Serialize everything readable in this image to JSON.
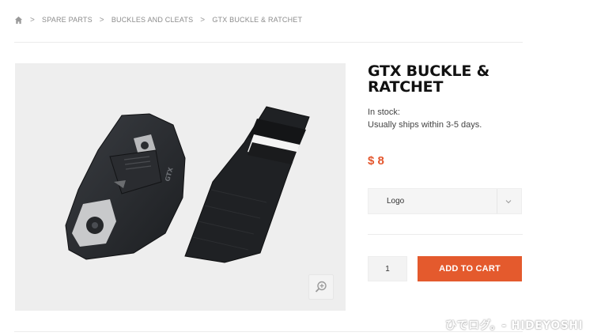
{
  "breadcrumb": {
    "home_icon": "home-icon",
    "separator": ">",
    "items": [
      "SPARE PARTS",
      "BUCKLES AND CLEATS",
      "GTX BUCKLE & RATCHET"
    ]
  },
  "product": {
    "title": "GTX BUCKLE & RATCHET",
    "stock_status": "In stock:",
    "shipping_note": "Usually ships within 3-5 days.",
    "price": "$ 8",
    "image_badge_text": "GTX"
  },
  "option_select": {
    "selected_value": "Logo",
    "icon": "chevron-down-icon"
  },
  "quantity": {
    "value": "1"
  },
  "add_to_cart_label": "ADD TO CART",
  "zoom_icon": "zoom-in-icon",
  "watermark": "ひでログ。- HIDEYOSHI",
  "colors": {
    "accent": "#e45a2d",
    "price": "#e4572e",
    "gallery_bg": "#eeeeee"
  }
}
